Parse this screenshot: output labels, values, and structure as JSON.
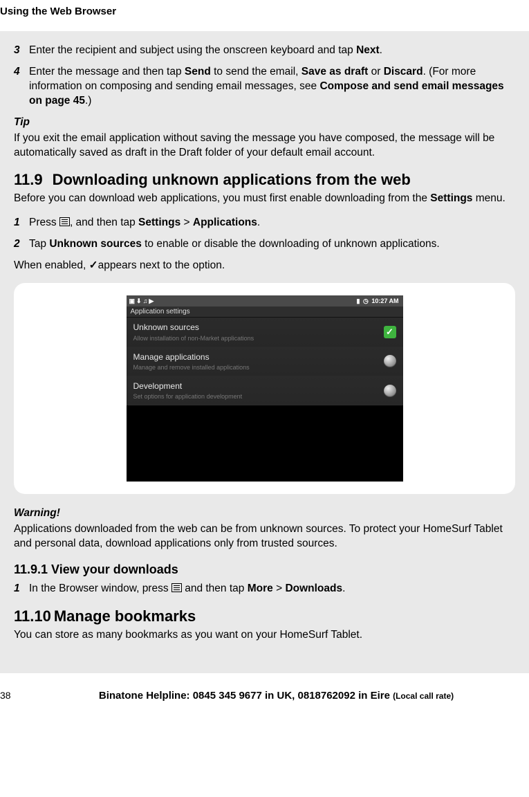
{
  "header": {
    "chapter_title": "Using the Web Browser"
  },
  "steps_a": [
    {
      "num": "3",
      "text_parts": [
        "Enter the recipient and subject using the onscreen keyboard and tap ",
        "Next",
        "."
      ]
    },
    {
      "num": "4",
      "text_parts": [
        "Enter the message and then tap ",
        "Send",
        " to send the email, ",
        "Save as draft",
        " or ",
        "Discard",
        ". (For more information on composing and sending email messages, see ",
        "Compose and send email messages on page 45",
        ".)"
      ]
    }
  ],
  "tip": {
    "label": "Tip",
    "text": "If you exit the email application without saving the message you have composed, the message will be automatically saved as draft in the Draft folder of your default email account."
  },
  "section119": {
    "num": "11.9",
    "title": "Downloading unknown applications from the web",
    "intro_parts": [
      "Before you can download web applications, you must first enable downloading from the ",
      "Settings",
      " menu."
    ],
    "steps": [
      {
        "num": "1",
        "parts": [
          "Press ",
          "MENU_ICON",
          ", and then tap ",
          "Settings",
          " > ",
          "Applications",
          "."
        ]
      },
      {
        "num": "2",
        "parts": [
          "Tap ",
          "Unknown sources",
          " to enable or disable the downloading of unknown applications."
        ]
      }
    ],
    "enabled_note_parts": [
      "When enabled, ",
      "✓",
      "appears next to the option."
    ]
  },
  "screenshot": {
    "status_time": "10:27 AM",
    "titlebar": "Application settings",
    "rows": [
      {
        "title": "Unknown sources",
        "sub": "Allow installation of non-Market applications",
        "control": "check"
      },
      {
        "title": "Manage applications",
        "sub": "Manage and remove installed applications",
        "control": "arrow"
      },
      {
        "title": "Development",
        "sub": "Set options for application development",
        "control": "arrow"
      }
    ]
  },
  "warning": {
    "label": "Warning!",
    "text": "Applications downloaded from the web can be from unknown sources. To protect your HomeSurf Tablet and personal data, download applications only from trusted sources."
  },
  "section1191": {
    "num_title": "11.9.1 View your downloads",
    "step": {
      "num": "1",
      "parts": [
        "In the Browser window, press ",
        "MENU_ICON",
        " and then tap ",
        "More",
        " > ",
        "Downloads",
        "."
      ]
    }
  },
  "section1110": {
    "num": "11.10",
    "title": "Manage bookmarks",
    "intro": "You can store as many bookmarks as you want on your HomeSurf Tablet."
  },
  "footer": {
    "page_num": "38",
    "helpline_main": "Binatone Helpline: 0845 345 9677 in UK, 0818762092 in Eire ",
    "helpline_small": "(Local call rate)"
  }
}
